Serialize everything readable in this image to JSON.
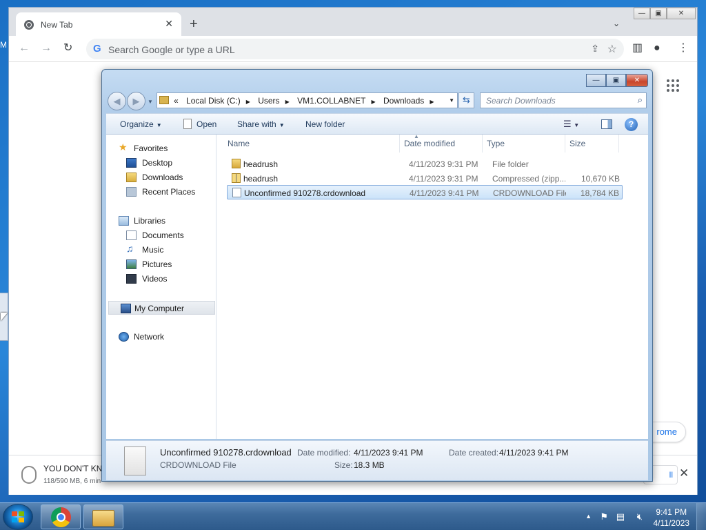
{
  "desktop": {
    "edge_label": "M"
  },
  "chrome": {
    "tab_title": "New Tab",
    "tab_close": "✕",
    "new_tab": "+",
    "omnibox_placeholder": "Search Google or type a URL",
    "customize_label": "rome",
    "download": {
      "name": "YOU DON'T KN",
      "status": "118/590 MB, 6 min",
      "show_all": "ll",
      "close": "✕"
    }
  },
  "explorer": {
    "address": {
      "overflow": "«",
      "crumbs": [
        "Local Disk (C:)",
        "Users",
        "VM1.COLLABNET",
        "Downloads"
      ]
    },
    "search_placeholder": "Search Downloads",
    "commands": {
      "organize": "Organize",
      "open": "Open",
      "share_with": "Share with",
      "new_folder": "New folder"
    },
    "nav": {
      "favorites": "Favorites",
      "desktop": "Desktop",
      "downloads": "Downloads",
      "recent_places": "Recent Places",
      "libraries": "Libraries",
      "documents": "Documents",
      "music": "Music",
      "pictures": "Pictures",
      "videos": "Videos",
      "my_computer": "My Computer",
      "network": "Network"
    },
    "columns": {
      "name": "Name",
      "date": "Date modified",
      "type": "Type",
      "size": "Size"
    },
    "files": [
      {
        "name": "headrush",
        "date": "4/11/2023 9:31 PM",
        "type": "File folder",
        "size": ""
      },
      {
        "name": "headrush",
        "date": "4/11/2023 9:31 PM",
        "type": "Compressed (zipp...",
        "size": "10,670 KB"
      },
      {
        "name": "Unconfirmed 910278.crdownload",
        "date": "4/11/2023 9:41 PM",
        "type": "CRDOWNLOAD File",
        "size": "18,784 KB"
      }
    ],
    "details": {
      "name": "Unconfirmed 910278.crdownload",
      "type": "CRDOWNLOAD File",
      "date_modified_label": "Date modified:",
      "date_modified": "4/11/2023 9:41 PM",
      "date_created_label": "Date created:",
      "date_created": "4/11/2023 9:41 PM",
      "size_label": "Size:",
      "size": "18.3 MB"
    }
  },
  "taskbar": {
    "time": "9:41 PM",
    "date": "4/11/2023"
  }
}
